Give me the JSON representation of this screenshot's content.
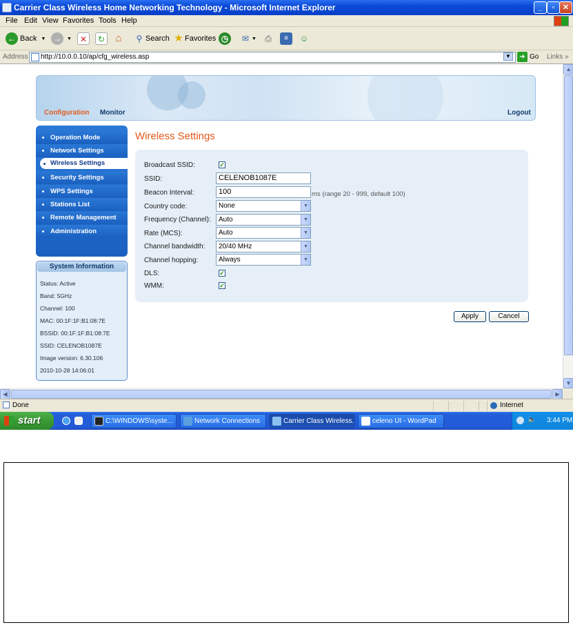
{
  "window": {
    "title": "Carrier Class Wireless Home Networking Technology - Microsoft Internet Explorer"
  },
  "menu": [
    "File",
    "Edit",
    "View",
    "Favorites",
    "Tools",
    "Help"
  ],
  "toolbar": {
    "back": "Back",
    "search": "Search",
    "favorites": "Favorites"
  },
  "address": {
    "label": "Address",
    "url": "http://10.0.0.10/ap/cfg_wireless.asp",
    "go": "Go",
    "links": "Links"
  },
  "status": {
    "text": "Done",
    "zone": "Internet"
  },
  "taskbar": {
    "start": "start",
    "tasks": [
      "C:\\WINDOWS\\syste...",
      "Network Connections",
      "Carrier Class Wireless...",
      "celeno UI - WordPad"
    ],
    "clock": "3:44 PM"
  },
  "page": {
    "tabs": {
      "configuration": "Configuration",
      "monitor": "Monitor",
      "logout": "Logout"
    },
    "nav": [
      "Operation Mode",
      "Network Settings",
      "Wireless Settings",
      "Security Settings",
      "WPS Settings",
      "Stations List",
      "Remote Management",
      "Administration"
    ],
    "sysinfo": {
      "title": "System Information",
      "rows": [
        "Status: Active",
        "Band: 5GHz",
        "Channel: 100",
        "MAC: 00:1F:1F:B1:08:7E",
        "BSSID: 00:1F:1F:B1:08:7E",
        "SSID: CELENOB1087E",
        "Image version: 6.30.106",
        "2010-10-28 14:06:01"
      ]
    },
    "title": "Wireless Settings",
    "form": {
      "labels": [
        "Broadcast SSID:",
        "SSID:",
        "Beacon Interval:",
        "Country code:",
        "Frequency (Channel):",
        "Rate (MCS):",
        "Channel bandwidth:",
        "Channel hopping:",
        "DLS:",
        "WMM:"
      ],
      "ssid": "CELENOB1087E",
      "beacon": "100",
      "beacon_hint": "ms (range 20 - 999, default 100)",
      "country": "None",
      "frequency": "Auto",
      "rate": "Auto",
      "bandwidth": "20/40 MHz",
      "hopping": "Always",
      "broadcast_checked": true,
      "dls_checked": true,
      "wmm_checked": true
    },
    "buttons": {
      "apply": "Apply",
      "cancel": "Cancel"
    }
  }
}
